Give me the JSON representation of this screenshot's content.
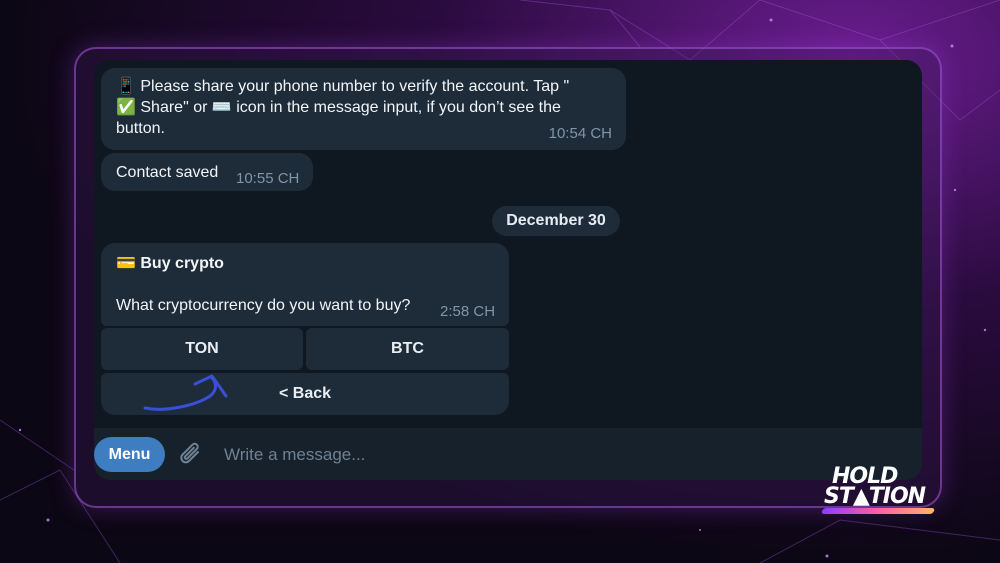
{
  "colors": {
    "chat_bg": "#0f1720",
    "bubble_bg": "#1e2c3a",
    "menu_button": "#3e7dc0",
    "time_text": "#7f95a8",
    "frame_border": "#a55adc",
    "annotation_arrow": "#3a4fd8"
  },
  "messages": [
    {
      "icon": "📱",
      "text": "Please share your phone number to verify the account. Tap \"",
      "text_line2_icon": "✅",
      "text_line2": "Share\" or ",
      "keyboard_icon": "⌨️",
      "text_line2_rest": "icon in the message input, if you don’t see the",
      "text_line3": "button.",
      "time": "10:54 CH"
    },
    {
      "text": "Contact saved",
      "time": "10:55 CH"
    }
  ],
  "date_separator": "December 30",
  "crypto_message": {
    "icon": "💳",
    "title": "Buy crypto",
    "question": "What cryptocurrency do you want to buy?",
    "time": "2:58 CH"
  },
  "keyboard": {
    "row1": [
      "TON",
      "BTC"
    ],
    "back": "< Back"
  },
  "input_bar": {
    "menu_label": "Menu",
    "placeholder": "Write a message..."
  },
  "logo": {
    "line1": "HOLD",
    "line2": "ST▲TION"
  }
}
